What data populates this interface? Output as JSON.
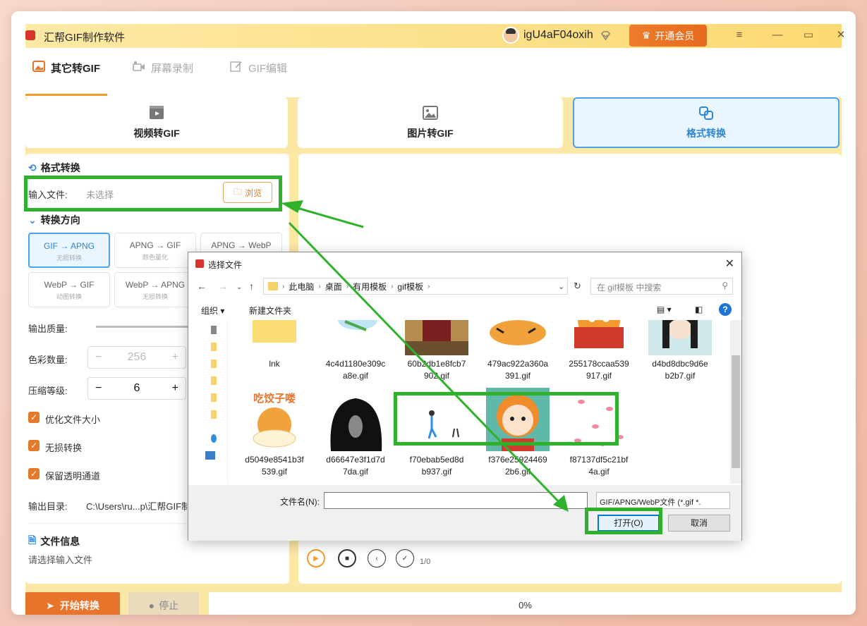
{
  "app": {
    "title": "汇帮GIF制作软件",
    "username": "igU4aF04oxih",
    "vip_label": "开通会员",
    "accent": "#e8732a"
  },
  "tabs": [
    {
      "label": "其它转GIF",
      "icon": "image-icon",
      "active": true
    },
    {
      "label": "屏幕录制",
      "icon": "camera-icon",
      "active": false
    },
    {
      "label": "GIF编辑",
      "icon": "edit-icon",
      "active": false
    }
  ],
  "modes": [
    {
      "label": "视频转GIF",
      "icon": "video-icon"
    },
    {
      "label": "图片转GIF",
      "icon": "picture-icon"
    },
    {
      "label": "格式转换",
      "icon": "convert-icon"
    }
  ],
  "panel": {
    "section_title": "格式转换",
    "input_label": "输入文件:",
    "input_value": "未选择",
    "browse_label": "浏览",
    "direction_title": "转换方向",
    "directions": [
      {
        "label": "GIF → APNG",
        "sub": "无损转换"
      },
      {
        "label": "APNG → GIF",
        "sub": "颜色量化"
      },
      {
        "label": "APNG → WebP",
        "sub": ""
      },
      {
        "label": "WebP → GIF",
        "sub": "动图转换"
      },
      {
        "label": "WebP → APNG",
        "sub": "无损转换"
      }
    ],
    "quality_label": "输出质量:",
    "colors_label": "色彩数量:",
    "colors_value": "256",
    "compress_label": "压缩等级:",
    "compress_value": "6",
    "checkboxes": [
      "优化文件大小",
      "无损转换",
      "保留透明通道"
    ],
    "output_label": "输出目录:",
    "output_value": "C:\\Users\\ru...p\\汇帮GIF制",
    "info_title": "文件信息",
    "info_text": "请选择输入文件"
  },
  "player": {
    "counter": "1/0"
  },
  "bottom": {
    "start_label": "开始转换",
    "stop_label": "停止",
    "progress_text": "0%"
  },
  "dialog": {
    "title": "选择文件",
    "breadcrumb": [
      "此电脑",
      "桌面",
      "有用模板",
      "gif模板"
    ],
    "search_placeholder": "在 gif模板 中搜索",
    "organize_label": "组织 ▾",
    "new_folder_label": "新建文件夹",
    "files": [
      {
        "name": "lnk",
        "line2": "",
        "kind": "folder"
      },
      {
        "name": "4c4d1180e309c",
        "line2": "a8e.gif",
        "kind": "bird"
      },
      {
        "name": "60b2db1e8fcb7",
        "line2": "902.gif",
        "kind": "person"
      },
      {
        "name": "479ac922a360a",
        "line2": "391.gif",
        "kind": "tiger"
      },
      {
        "name": "255178ccaa539",
        "line2": "917.gif",
        "kind": "tiger2"
      },
      {
        "name": "d4bd8dbc9d6e",
        "line2": "b2b7.gif",
        "kind": "girl"
      },
      {
        "name": "d5049e8541b3f",
        "line2": "539.gif",
        "kind": "tiger3",
        "caption": "吃饺子喽"
      },
      {
        "name": "d66647e3f1d7d",
        "line2": "7da.gif",
        "kind": "blob"
      },
      {
        "name": "f70ebab5ed8d",
        "line2": "b937.gif",
        "kind": "walk"
      },
      {
        "name": "f376e25924469",
        "line2": "2b6.gif",
        "kind": "cartoon"
      },
      {
        "name": "f87137df5c21bf",
        "line2": "4a.gif",
        "kind": "petals"
      }
    ],
    "filename_label": "文件名(N):",
    "filename_value": "",
    "filter_value": "GIF/APNG/WebP文件 (*.gif *.",
    "open_label": "打开(O)",
    "cancel_label": "取消"
  },
  "annotation_color": "#2fb12b"
}
